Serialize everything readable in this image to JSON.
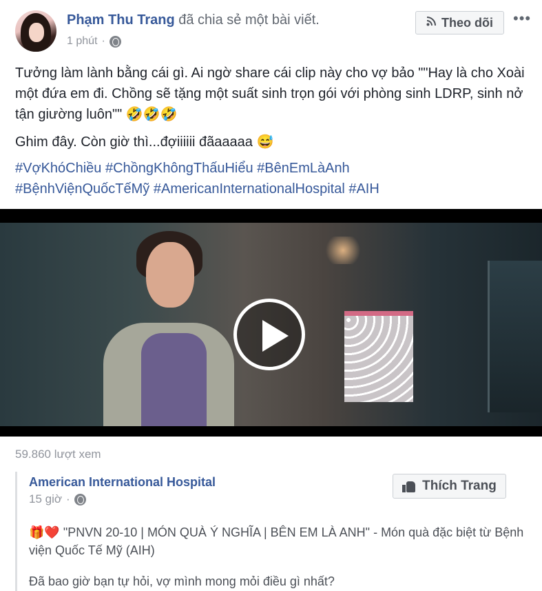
{
  "post": {
    "author": "Phạm Thu Trang",
    "action": "đã chia sẻ một bài viết.",
    "time": "1 phút",
    "follow_label": "Theo dõi",
    "more": "•••",
    "text_line1": "Tưởng làm lành bằng cái gì. Ai ngờ share cái clip này cho vợ bảo \"\"Hay là cho Xoài một đứa em đi. Chồng sẽ tặng một suất sinh trọn gói với phòng sinh LDRP, sinh nở tận giường luôn\"\" 🤣🤣🤣",
    "text_line2": "Ghim đây. Còn giờ thì...đợiiiiii đãaaaaa 😅",
    "hashtags_line1": "#VợKhóChiều #ChồngKhôngThấuHiểu #BênEmLàAnh",
    "hashtags_line2": "#BệnhViệnQuốcTếMỹ #AmericanInternationalHospital #AIH",
    "views": "59.860 lượt xem"
  },
  "shared": {
    "page_name": "American International Hospital",
    "time": "15 giờ",
    "like_label": "Thích Trang",
    "text1": "🎁❤️ \"PNVN 20-10 | MÓN QUÀ Ý NGHĨA | BÊN EM LÀ ANH\" - Món quà đặc biệt từ Bệnh viện Quốc Tế Mỹ (AIH)",
    "text2": "Đã bao giờ bạn tự hỏi, vợ mình mong mỏi điều gì nhất?"
  },
  "colors": {
    "link": "#365899",
    "meta": "#90949c",
    "button_bg": "#f5f6f7"
  },
  "icons": {
    "globe": "globe-icon",
    "rss": "rss-icon",
    "thumb": "thumbs-up-icon",
    "play": "play-icon"
  }
}
